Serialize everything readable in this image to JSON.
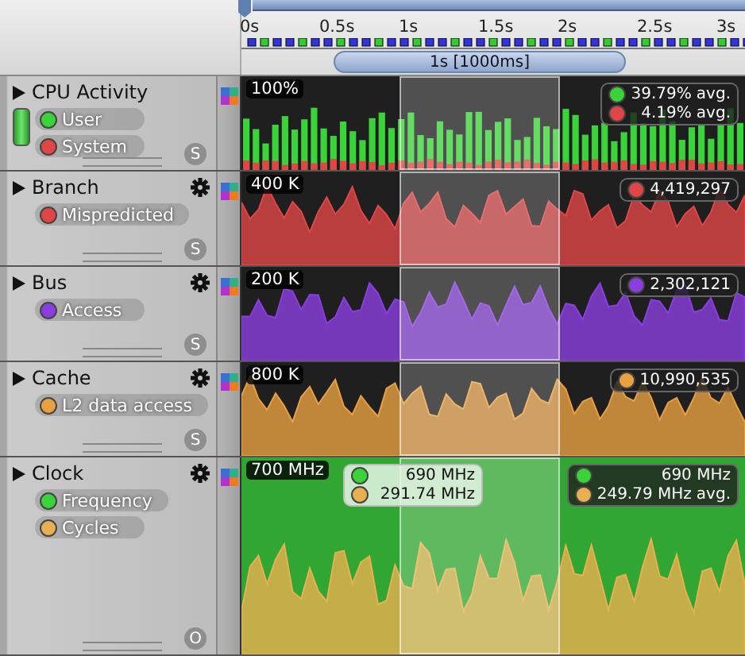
{
  "ruler": {
    "ticks": [
      "0s",
      "0.5s",
      "1s",
      "1.5s",
      "2s",
      "2.5s",
      "3s"
    ],
    "selection": "1s [1000ms]"
  },
  "tracks": [
    {
      "name": "CPU Activity",
      "kind": "bars",
      "expanded": false,
      "settings": false,
      "mode": "S",
      "scale": "100%",
      "series": [
        {
          "label": "User",
          "color": "#3ad43a"
        },
        {
          "label": "System",
          "color": "#e04646"
        }
      ],
      "readouts": [
        {
          "lines": [
            {
              "color": "#3ad43a",
              "value": "39.79%",
              "note": "avg."
            },
            {
              "color": "#e04646",
              "value": "4.19%",
              "note": "avg."
            }
          ]
        }
      ]
    },
    {
      "name": "Branch",
      "kind": "area",
      "expanded": false,
      "settings": true,
      "mode": "S",
      "scale": "400 K",
      "series": [
        {
          "label": "Mispredicted",
          "color": "#e04646"
        }
      ],
      "readouts": [
        {
          "lines": [
            {
              "color": "#e04646",
              "value": "4,419,297"
            }
          ]
        }
      ]
    },
    {
      "name": "Bus",
      "kind": "area",
      "expanded": false,
      "settings": true,
      "mode": "S",
      "scale": "200 K",
      "series": [
        {
          "label": "Access",
          "color": "#8a3ee0"
        }
      ],
      "readouts": [
        {
          "lines": [
            {
              "color": "#8a3ee0",
              "value": "2,302,121"
            }
          ]
        }
      ]
    },
    {
      "name": "Cache",
      "kind": "area",
      "expanded": false,
      "settings": true,
      "mode": "S",
      "scale": "800 K",
      "series": [
        {
          "label": "L2 data access",
          "color": "#e8a040"
        }
      ],
      "readouts": [
        {
          "lines": [
            {
              "color": "#e8a040",
              "value": "10,990,535"
            }
          ]
        }
      ]
    },
    {
      "name": "Clock",
      "kind": "dual",
      "expanded": false,
      "settings": true,
      "mode": "O",
      "scale": "700 MHz",
      "series": [
        {
          "label": "Frequency",
          "color": "#3ad43a"
        },
        {
          "label": "Cycles",
          "color": "#e8b050"
        }
      ],
      "readouts": [
        {
          "lines": [
            {
              "color": "#3ad43a",
              "value": "690 MHz"
            },
            {
              "color": "#e8b050",
              "value": "291.74 MHz"
            }
          ]
        },
        {
          "lines": [
            {
              "color": "#3ad43a",
              "value": "690 MHz"
            },
            {
              "color": "#e8b050",
              "value": "249.79 MHz",
              "note": "avg."
            }
          ]
        }
      ]
    }
  ]
}
